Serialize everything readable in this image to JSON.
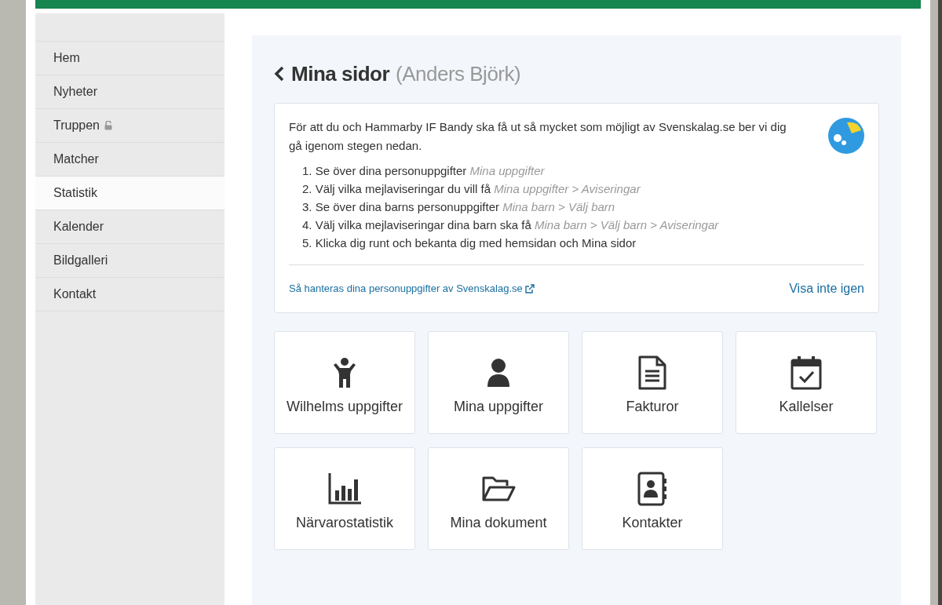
{
  "nav": [
    {
      "label": "Hem",
      "selected": false,
      "locked": false
    },
    {
      "label": "Nyheter",
      "selected": false,
      "locked": false
    },
    {
      "label": "Truppen",
      "selected": false,
      "locked": true
    },
    {
      "label": "Matcher",
      "selected": false,
      "locked": false
    },
    {
      "label": "Statistik",
      "selected": true,
      "locked": false
    },
    {
      "label": "Kalender",
      "selected": false,
      "locked": false
    },
    {
      "label": "Bildgalleri",
      "selected": false,
      "locked": false
    },
    {
      "label": "Kontakt",
      "selected": false,
      "locked": false
    }
  ],
  "page": {
    "title": "Mina sidor",
    "subtitle": "(Anders Björk)"
  },
  "intro": {
    "text": "För att du och Hammarby IF Bandy ska få ut så mycket som möjligt av Svenskalag.se ber vi dig gå igenom stegen nedan.",
    "steps": [
      {
        "number": "1.",
        "text": "Se över dina personuppgifter",
        "path": "Mina uppgifter"
      },
      {
        "number": "2.",
        "text": "Välj vilka mejlaviseringar du vill få",
        "path": "Mina uppgifter > Aviseringar"
      },
      {
        "number": "3.",
        "text": "Se över dina barns personuppgifter",
        "path": "Mina barn > Välj barn"
      },
      {
        "number": "4.",
        "text": "Välj vilka mejlaviseringar dina barn ska få",
        "path": "Mina barn > Välj barn > Aviseringar"
      },
      {
        "number": "5.",
        "text": "Klicka dig runt och bekanta dig med hemsidan och Mina sidor"
      }
    ],
    "privacy_link": "Så hanteras dina personuppgifter av Svenskalag.se",
    "dismiss_link": "Visa inte igen"
  },
  "tiles": [
    {
      "kind": "child",
      "label": "Wilhelms uppgifter"
    },
    {
      "kind": "user",
      "label": "Mina uppgifter"
    },
    {
      "kind": "invoice",
      "label": "Fakturor"
    },
    {
      "kind": "calendar",
      "label": "Kallelser"
    },
    {
      "kind": "stats",
      "label": "Närvarostatistik"
    },
    {
      "kind": "folder",
      "label": "Mina dokument"
    },
    {
      "kind": "contacts",
      "label": "Kontakter"
    }
  ]
}
